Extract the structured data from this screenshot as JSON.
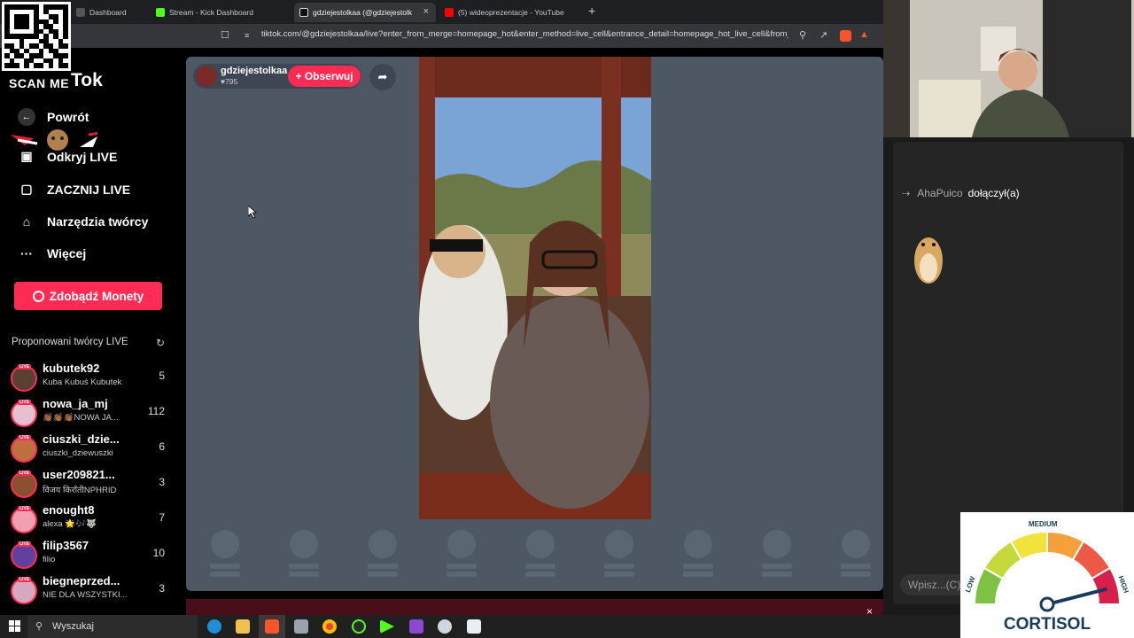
{
  "browser": {
    "tabs": [
      {
        "label": "Dashboard",
        "color": "#555555"
      },
      {
        "label": "Stream - Kick Dashboard",
        "color": "#53fc18"
      },
      {
        "label": "gdziejestolkaa (@gdziejestolk",
        "color": "#ffffff",
        "active": true
      },
      {
        "label": "(5) wideoprezentacje - YouTube",
        "color": "#ff0000"
      }
    ],
    "new_tab": "+",
    "tab_close": "×",
    "url": "tiktok.com/@gdziejestolkaa/live?enter_from_merge=homepage_hot&enter_method=live_cell&entrance_detail=homepage_hot_live_cell&from_..."
  },
  "overlay": {
    "scan_me": "SCAN ME",
    "logo_text": "Tok"
  },
  "sidebar": {
    "back": "Powrót",
    "items": [
      {
        "label": "Odkryj LIVE",
        "icon": "tv-icon"
      },
      {
        "label": "ZACZNIJ LIVE",
        "icon": "camera-icon"
      },
      {
        "label": "Narzędzia twórcy",
        "icon": "lightbulb-icon"
      },
      {
        "label": "Więcej",
        "icon": "more-icon"
      }
    ],
    "coins_button": "Zdobądź Monety",
    "suggested_heading": "Proponowani twórcy LIVE",
    "live_badge": "LIVE",
    "creators": [
      {
        "name": "kubutek92",
        "sub": "Kuba Kubuś Kubutek",
        "count": "5"
      },
      {
        "name": "nowa_ja_mj",
        "sub": "👏🏾👏🏾👏🏾NOWA JA...",
        "count": "112"
      },
      {
        "name": "ciuszki_dzie...",
        "sub": "ciuszki_dziewuszki",
        "count": "6"
      },
      {
        "name": "user209821...",
        "sub": "विजय किरॉतीNPHRID",
        "count": "3"
      },
      {
        "name": "enought8",
        "sub": "alexa 🌟🎶🐺",
        "count": "7"
      },
      {
        "name": "filip3567",
        "sub": "filio",
        "count": "10"
      },
      {
        "name": "biegneprzed...",
        "sub": "NIE DLA WSZYSTKI...",
        "count": "3"
      }
    ]
  },
  "stream": {
    "host_name": "gdziejestolkaa",
    "likes": "795",
    "follow_button": "+ Obserwuj",
    "close": "×"
  },
  "chat": {
    "join_user": "AhaPuico",
    "join_text": "dołączył(a)",
    "input_placeholder": "Wpisz...(C)"
  },
  "cortisol_gauge": {
    "title": "CORTISOL",
    "labels": {
      "low": "LOW",
      "medium": "MEDIUM",
      "high": "HIGH"
    },
    "level": 0.92,
    "colors": [
      "#7dc243",
      "#c5d93a",
      "#f2e23c",
      "#f5a03b",
      "#ec5a46",
      "#d81e4b"
    ]
  },
  "taskbar": {
    "search": "Wyszukaj"
  }
}
